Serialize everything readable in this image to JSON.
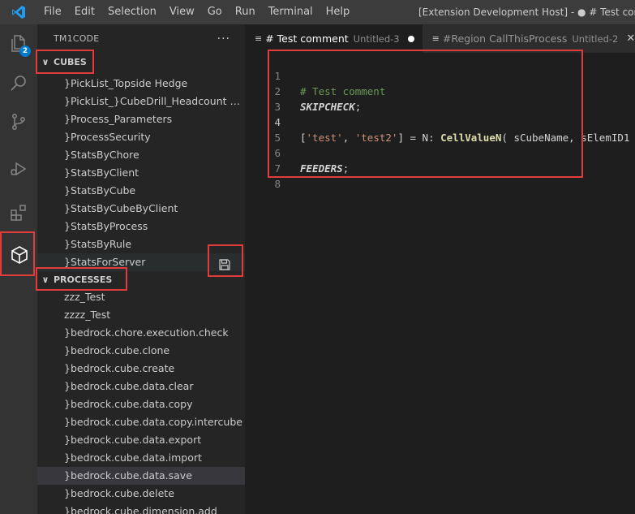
{
  "menu": {
    "items": [
      "File",
      "Edit",
      "Selection",
      "View",
      "Go",
      "Run",
      "Terminal",
      "Help"
    ],
    "window_title": "[Extension Development Host] - ● # Test comment"
  },
  "activity_bar": {
    "explorer_badge": "2",
    "icons": [
      "files-icon",
      "search-icon",
      "source-control-icon",
      "run-debug-icon",
      "extensions-icon",
      "tm1-cube-icon"
    ]
  },
  "sidebar": {
    "title": "TM1CODE",
    "more_label": "···",
    "cubes": {
      "label": "CUBES",
      "items": [
        "}PickList_Topside Hedge",
        "}PickList_}CubeDrill_Headcount By ...",
        "}Process_Parameters",
        "}ProcessSecurity",
        "}StatsByChore",
        "}StatsByClient",
        "}StatsByCube",
        "}StatsByCubeByClient",
        "}StatsByProcess",
        "}StatsByRule",
        "}StatsForServer"
      ]
    },
    "processes": {
      "label": "PROCESSES",
      "items": [
        "zzz_Test",
        "zzzz_Test",
        "}bedrock.chore.execution.check",
        "}bedrock.cube.clone",
        "}bedrock.cube.create",
        "}bedrock.cube.data.clear",
        "}bedrock.cube.data.copy",
        "}bedrock.cube.data.copy.intercube",
        "}bedrock.cube.data.export",
        "}bedrock.cube.data.import",
        "}bedrock.cube.data.save",
        "}bedrock.cube.delete",
        "}bedrock.cube.dimension.add"
      ]
    }
  },
  "tabs": [
    {
      "label": "# Test comment",
      "desc": "Untitled-3",
      "active": true
    },
    {
      "label": "#Region CallThisProcess",
      "desc": "Untitled-2",
      "active": false
    }
  ],
  "editor": {
    "line_numbers": [
      "1",
      "2",
      "3",
      "4",
      "5",
      "6",
      "7",
      "8"
    ],
    "line1_comment": "# Test comment",
    "line2_kw": "SKIPCHECK",
    "line2_punc": ";",
    "line4": {
      "open": "[",
      "str1": "'test'",
      "comma": ", ",
      "str2": "'test2'",
      "close": "] = N: ",
      "fn": "CellValueN",
      "args": "( sCubeName, sElemID1"
    },
    "line6_kw": "FEEDERS",
    "line6_punc": ";"
  },
  "colors": {
    "annotation": "#e03c3c",
    "accent": "#007acc"
  }
}
